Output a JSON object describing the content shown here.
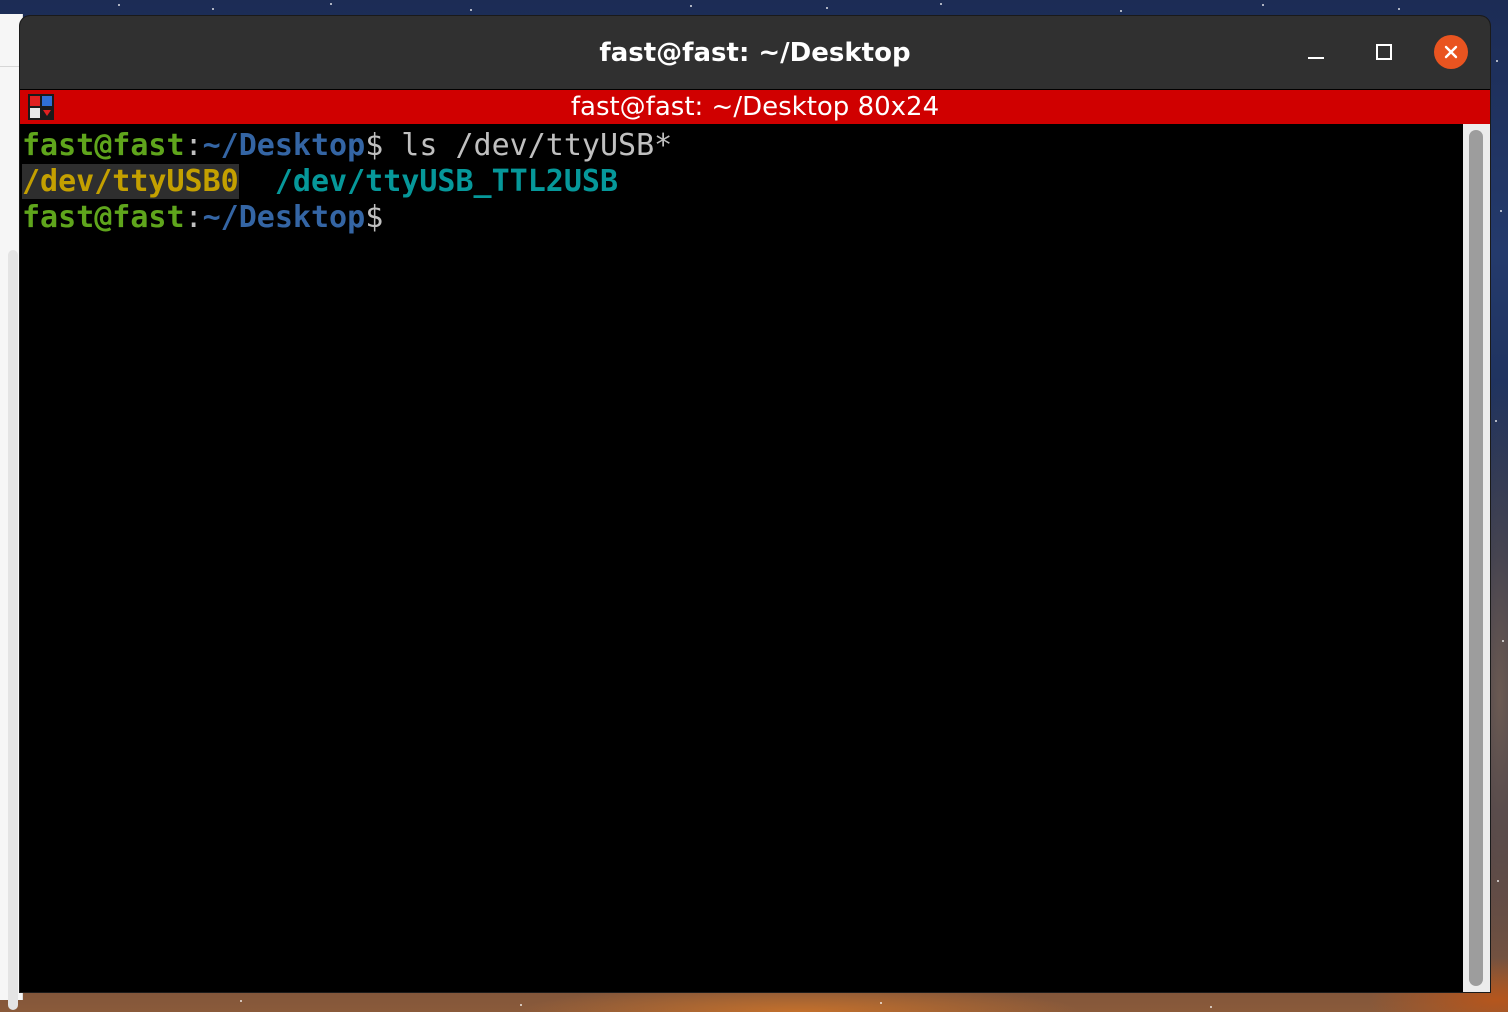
{
  "window": {
    "title": "fast@fast: ~/Desktop",
    "buttons": {
      "minimize_icon": "minimize-icon",
      "maximize_icon": "maximize-icon",
      "close_icon": "close-icon",
      "close_color": "#e95420"
    }
  },
  "tab": {
    "title": "fast@fast: ~/Desktop 80x24",
    "color": "#d00000",
    "icon": "terminator-icon"
  },
  "terminal": {
    "lines": [
      {
        "prompt_user": "fast@fast",
        "prompt_sep": ":",
        "prompt_path": "~/Desktop",
        "prompt_symbol": "$",
        "command": " ls /dev/ttyUSB*"
      },
      {
        "output": [
          "/dev/ttyUSB0",
          "/dev/ttyUSB_TTL2USB"
        ]
      },
      {
        "prompt_user": "fast@fast",
        "prompt_sep": ":",
        "prompt_path": "~/Desktop",
        "prompt_symbol": "$"
      }
    ],
    "colors": {
      "prompt_user": "#5fa51c",
      "prompt_path": "#3465a4",
      "output_device": "#c4a000",
      "output_link": "#06989a"
    }
  }
}
